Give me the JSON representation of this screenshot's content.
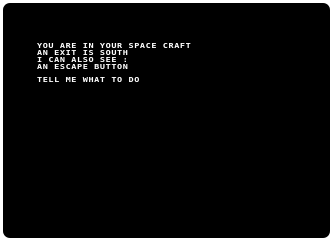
{
  "colors": {
    "screen_background": "#000000",
    "text": "#ffffff",
    "bezel": "#ffffff"
  },
  "terminal": {
    "lines": [
      "YOU ARE IN YOUR SPACE CRAFT",
      "AN EXIT IS SOUTH",
      "I CAN ALSO SEE :",
      "AN ESCAPE BUTTON",
      "TELL ME WHAT TO DO"
    ]
  }
}
